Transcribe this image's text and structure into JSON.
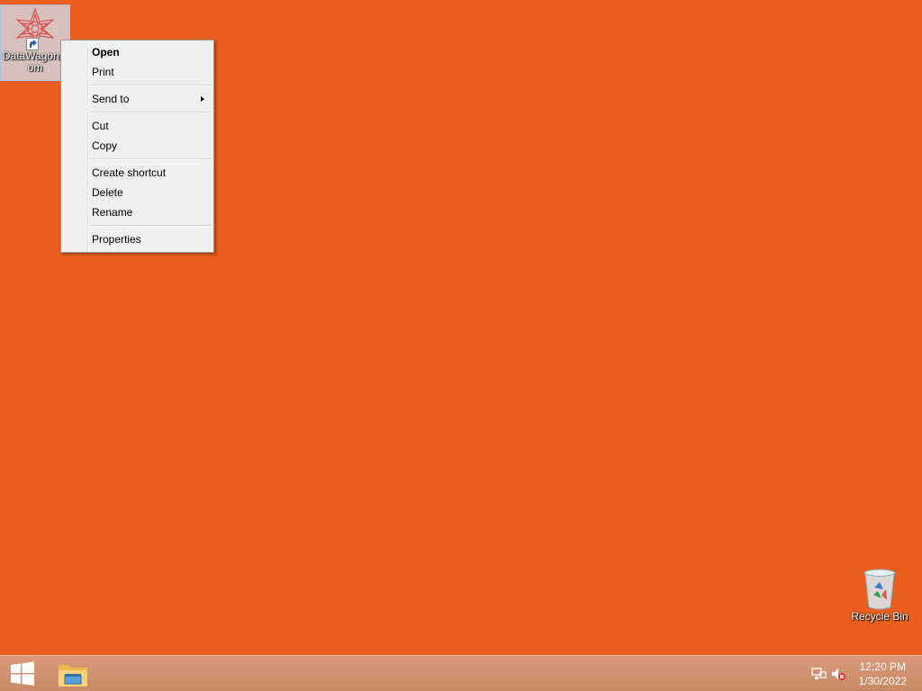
{
  "desktop": {
    "background_color": "#e95e1c",
    "icons": [
      {
        "label": "DataWagon.com",
        "icon": "datawagon-logo-icon",
        "shortcut": true,
        "selected": true
      },
      {
        "label": "Recycle Bin",
        "icon": "recycle-bin-icon"
      }
    ]
  },
  "context_menu": {
    "groups": [
      [
        {
          "label": "Open",
          "default": true
        },
        {
          "label": "Print"
        }
      ],
      [
        {
          "label": "Send to",
          "submenu": true
        }
      ],
      [
        {
          "label": "Cut"
        },
        {
          "label": "Copy"
        }
      ],
      [
        {
          "label": "Create shortcut"
        },
        {
          "label": "Delete"
        },
        {
          "label": "Rename"
        }
      ],
      [
        {
          "label": "Properties"
        }
      ]
    ]
  },
  "taskbar": {
    "start_icon": "windows-logo-icon",
    "pinned": [
      {
        "icon": "file-explorer-icon"
      }
    ],
    "tray": {
      "icons": [
        "network-icon",
        "volume-muted-icon"
      ],
      "time": "12:20 PM",
      "date": "1/30/2022"
    }
  }
}
